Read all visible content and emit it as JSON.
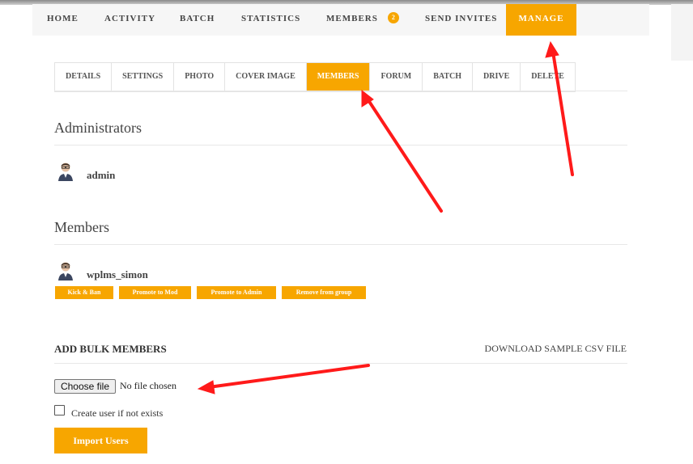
{
  "main_nav": {
    "items": [
      {
        "label": "HOME"
      },
      {
        "label": "ACTIVITY"
      },
      {
        "label": "BATCH"
      },
      {
        "label": "STATISTICS"
      },
      {
        "label": "MEMBERS",
        "badge": "2"
      },
      {
        "label": "SEND INVITES"
      },
      {
        "label": "MANAGE",
        "active": true
      }
    ]
  },
  "sub_tabs": [
    {
      "label": "DETAILS"
    },
    {
      "label": "SETTINGS"
    },
    {
      "label": "PHOTO"
    },
    {
      "label": "COVER IMAGE"
    },
    {
      "label": "MEMBERS",
      "active": true
    },
    {
      "label": "FORUM"
    },
    {
      "label": "BATCH"
    },
    {
      "label": "DRIVE"
    },
    {
      "label": "DELETE"
    }
  ],
  "administrators": {
    "heading": "Administrators",
    "users": [
      {
        "name": "admin"
      }
    ]
  },
  "members": {
    "heading": "Members",
    "users": [
      {
        "name": "wplms_simon"
      }
    ],
    "actions": [
      "Kick & Ban",
      "Promote to Mod",
      "Promote to Admin",
      "Remove from group"
    ]
  },
  "bulk": {
    "title": "ADD BULK MEMBERS",
    "download_link": "DOWNLOAD SAMPLE CSV FILE",
    "choose_file": "Choose file",
    "no_file": "No file chosen",
    "checkbox_label": "Create user if not exists",
    "import_button": "Import Users"
  },
  "colors": {
    "accent": "#f7a600",
    "annotation_arrow": "#ff1a1a"
  },
  "icons": {
    "avatar": "user-avatar-icon",
    "arrow": "red-annotation-arrow"
  }
}
